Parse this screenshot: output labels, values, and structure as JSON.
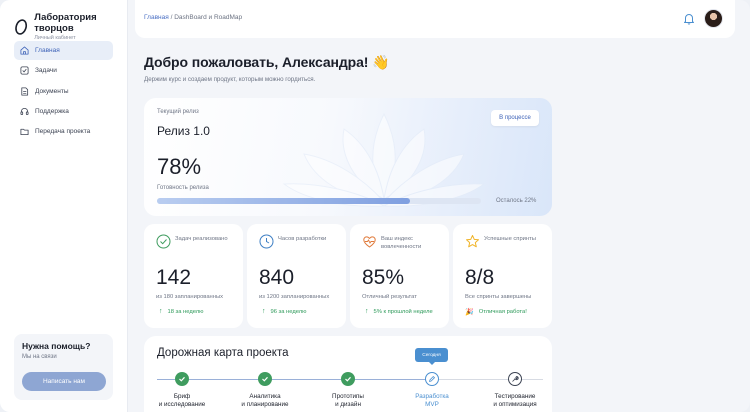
{
  "brand": {
    "name": "Лаборатория творцов",
    "subtitle": "Личный кабинет"
  },
  "sidebar": {
    "items": [
      {
        "label": "Главная",
        "icon": "home-icon",
        "active": true
      },
      {
        "label": "Задачи",
        "icon": "checkbox-icon",
        "active": false
      },
      {
        "label": "Документы",
        "icon": "document-icon",
        "active": false
      },
      {
        "label": "Поддержка",
        "icon": "headset-icon",
        "active": false
      },
      {
        "label": "Передача проекта",
        "icon": "folder-icon",
        "active": false
      }
    ],
    "help": {
      "title": "Нужна помощь?",
      "subtitle": "Мы на связи",
      "button": "Написать нам"
    }
  },
  "header": {
    "breadcrumb_home": "Главная",
    "breadcrumb_sep": "/",
    "breadcrumb_current": "DashBoard и RoadMap"
  },
  "greeting": {
    "title": "Добро пожаловать, Александра! 👋",
    "subtitle": "Держим курс и создаем продукт, которым можно гордиться."
  },
  "release": {
    "label": "Текущий релиз",
    "title": "Релиз 1.0",
    "status": "В процессе",
    "percent": "78%",
    "progress": 78,
    "ready_label": "Готовность релиза",
    "remaining": "Осталось 22%"
  },
  "stats": [
    {
      "label": "Задач реализовано",
      "value": "142",
      "sub": "из 180 запланированных",
      "trend": "18 за неделю",
      "trend_icon": "↑",
      "icon": "check-circle-icon"
    },
    {
      "label": "Часов разработки",
      "value": "840",
      "sub": "из 1200 запланированных",
      "trend": "96 за неделю",
      "trend_icon": "↑",
      "icon": "clock-icon"
    },
    {
      "label": "Ваш индекс вовлеченности",
      "value": "85%",
      "sub": "Отличный результат",
      "trend": "5% к прошлой неделе",
      "trend_icon": "↑",
      "icon": "heart-pulse-icon"
    },
    {
      "label": "Успешные спринты",
      "value": "8/8",
      "sub": "Все спринты завершены",
      "trend": "Отличная работа!",
      "trend_icon": "🎉",
      "icon": "star-icon"
    }
  ],
  "roadmap": {
    "title": "Дорожная карта проекта",
    "today": "Сегодня",
    "steps": [
      {
        "line1": "Бриф",
        "line2": "и исследование",
        "state": "done"
      },
      {
        "line1": "Аналитика",
        "line2": "и планирование",
        "state": "done"
      },
      {
        "line1": "Прототипы",
        "line2": "и дизайн",
        "state": "done"
      },
      {
        "line1": "Разработка",
        "line2": "MVP",
        "state": "current"
      },
      {
        "line1": "Тестирование",
        "line2": "и оптимизация",
        "state": "todo"
      }
    ]
  },
  "colors": {
    "accent": "#3e63b8",
    "success": "#3f9c5f",
    "current": "#4a8fd0",
    "warn": "#e07a3a",
    "star": "#f0b429"
  }
}
